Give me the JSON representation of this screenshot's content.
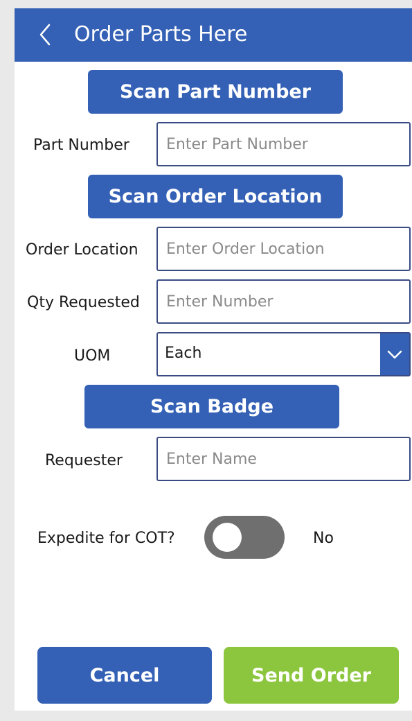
{
  "header": {
    "title": "Order Parts Here",
    "back_icon": "chevron-left-icon"
  },
  "scan_part_button": {
    "label": "Scan Part Number"
  },
  "part_number": {
    "label": "Part Number",
    "value": "",
    "placeholder": "Enter Part Number"
  },
  "scan_location_button": {
    "label": "Scan Order Location"
  },
  "order_location": {
    "label": "Order Location",
    "value": "",
    "placeholder": "Enter Order Location"
  },
  "qty_requested": {
    "label": "Qty Requested",
    "value": "",
    "placeholder": "Enter Number"
  },
  "uom": {
    "label": "UOM",
    "selected": "Each",
    "icon": "chevron-down-icon"
  },
  "scan_badge_button": {
    "label": "Scan Badge"
  },
  "requester": {
    "label": "Requester",
    "value": "",
    "placeholder": "Enter Name"
  },
  "expedite": {
    "label": "Expedite for COT?",
    "state_text": "No",
    "on": false
  },
  "footer": {
    "cancel_label": "Cancel",
    "send_label": "Send Order"
  },
  "colors": {
    "header_blue": "#3461b5",
    "send_green": "#8cc63e",
    "toggle_off": "#6f6f6f",
    "input_border": "#3a4b84"
  }
}
